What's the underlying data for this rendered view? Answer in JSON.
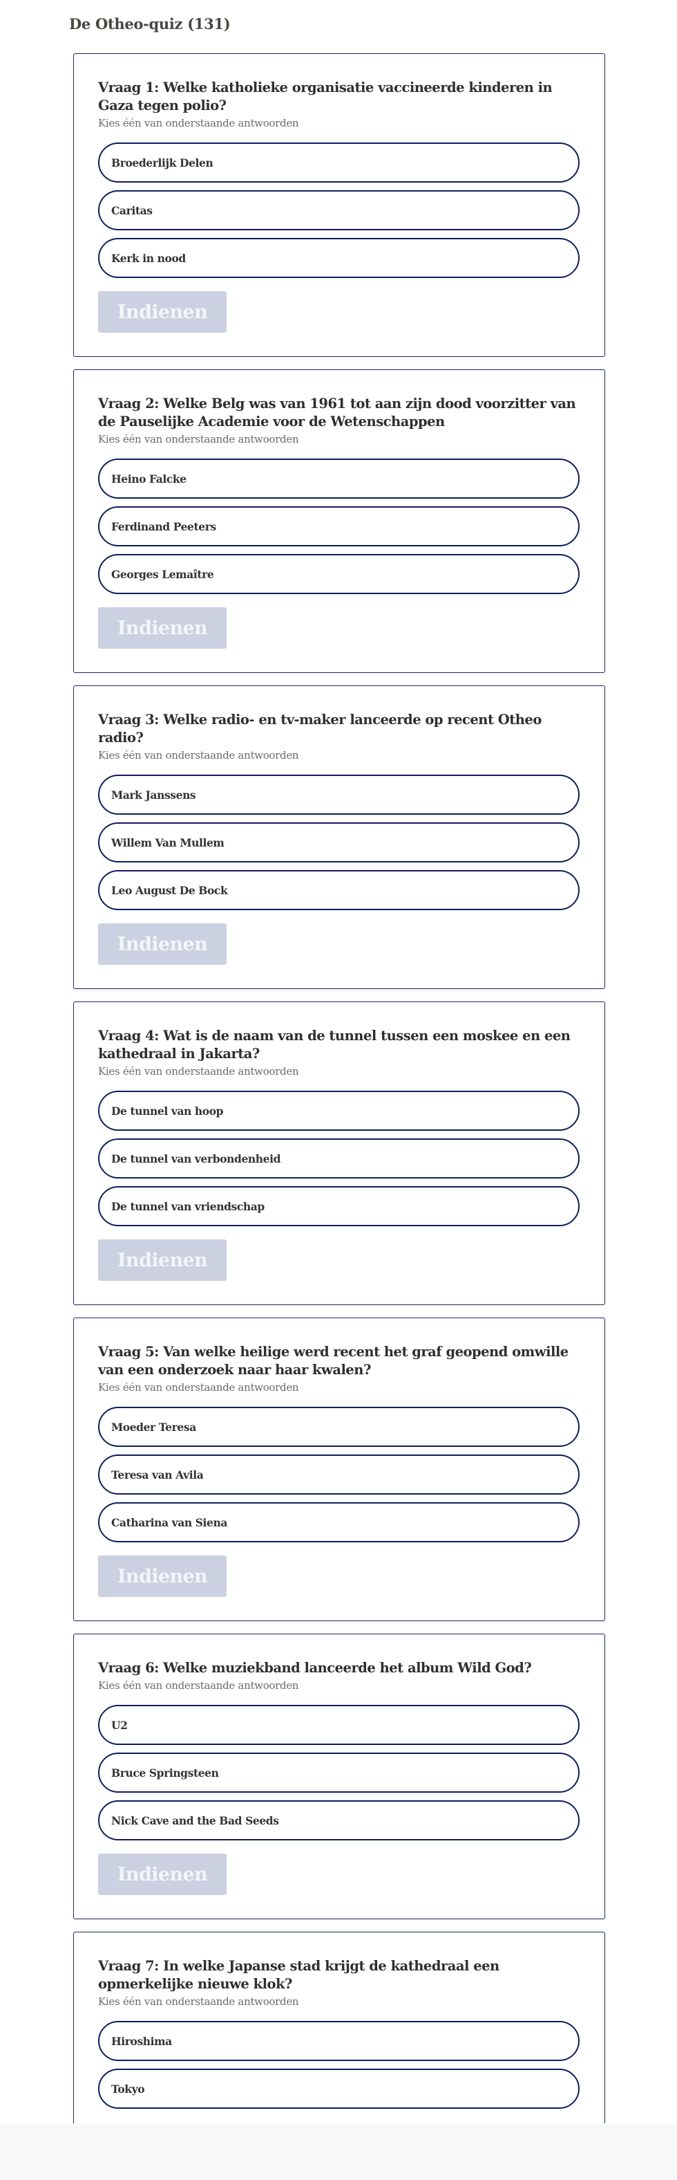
{
  "page": {
    "title": "De Otheo-quiz (131)"
  },
  "common": {
    "instruction": "Kies één van onderstaande antwoorden",
    "submit_label": "Indienen"
  },
  "colors": {
    "border": "#0d1f5c",
    "submit_disabled_bg": "#cbd1e1",
    "heading": "#4a4540"
  },
  "questions": [
    {
      "title": "Vraag 1: Welke katholieke organisatie vaccineerde kinderen in Gaza tegen polio?",
      "options": [
        "Broederlijk Delen",
        "Caritas",
        "Kerk in nood"
      ]
    },
    {
      "title": "Vraag 2: Welke Belg was van 1961 tot aan zijn dood voorzitter van de Pauselijke Academie voor de Wetenschappen",
      "options": [
        "Heino Falcke",
        "Ferdinand Peeters",
        "Georges Lemaître"
      ]
    },
    {
      "title": "Vraag 3: Welke radio- en tv-maker lanceerde op recent Otheo radio?",
      "options": [
        "Mark Janssens",
        "Willem Van Mullem",
        "Leo August De Bock"
      ]
    },
    {
      "title": "Vraag 4: Wat is de naam van de tunnel tussen een moskee en een kathedraal in Jakarta?",
      "options": [
        "De tunnel van hoop",
        "De tunnel van verbondenheid",
        "De tunnel van vriendschap"
      ]
    },
    {
      "title": "Vraag 5: Van welke heilige werd recent het graf geopend omwille van een onderzoek naar haar kwalen?",
      "options": [
        "Moeder Teresa",
        "Teresa van Avila",
        "Catharina van Siena"
      ]
    },
    {
      "title": "Vraag 6: Welke muziekband lanceerde het album Wild God?",
      "options": [
        "U2",
        "Bruce Springsteen",
        "Nick Cave and the Bad Seeds"
      ]
    },
    {
      "title": "Vraag 7: In welke Japanse stad krijgt de kathedraal een opmerkelijke nieuwe klok?",
      "options": [
        "Hiroshima",
        "Tokyo"
      ]
    }
  ]
}
